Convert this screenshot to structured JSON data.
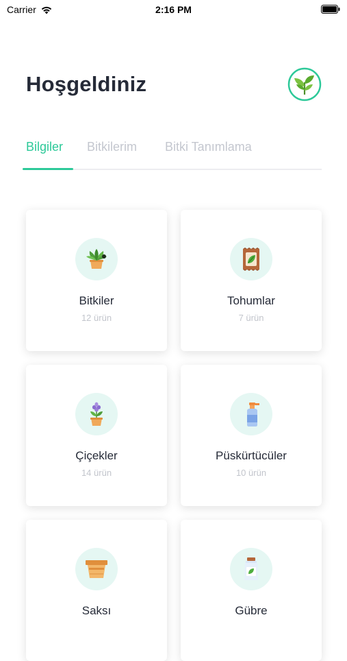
{
  "status_bar": {
    "carrier": "Carrier",
    "time": "2:16 PM"
  },
  "header": {
    "title": "Hoşgeldiniz",
    "logo_icon": "plant-logo-icon"
  },
  "tabs": [
    {
      "label": "Bilgiler",
      "active": true
    },
    {
      "label": "Bitkilerim",
      "active": false
    },
    {
      "label": "Bitki Tanımlama",
      "active": false
    }
  ],
  "colors": {
    "accent": "#2dc999",
    "icon_circle": "#e5f7f3",
    "title_text": "#262b38",
    "muted_text": "#c2c5cc"
  },
  "categories": [
    {
      "name": "Bitkiler",
      "count": "12 ürün",
      "icon": "potted-plant-icon"
    },
    {
      "name": "Tohumlar",
      "count": "7 ürün",
      "icon": "seed-packet-icon"
    },
    {
      "name": "Çiçekler",
      "count": "14 ürün",
      "icon": "flower-pot-icon"
    },
    {
      "name": "Püskürtücüler",
      "count": "10 ürün",
      "icon": "spray-bottle-icon"
    },
    {
      "name": "Saksı",
      "count": "",
      "icon": "planter-box-icon"
    },
    {
      "name": "Gübre",
      "count": "",
      "icon": "fertilizer-jar-icon"
    }
  ]
}
